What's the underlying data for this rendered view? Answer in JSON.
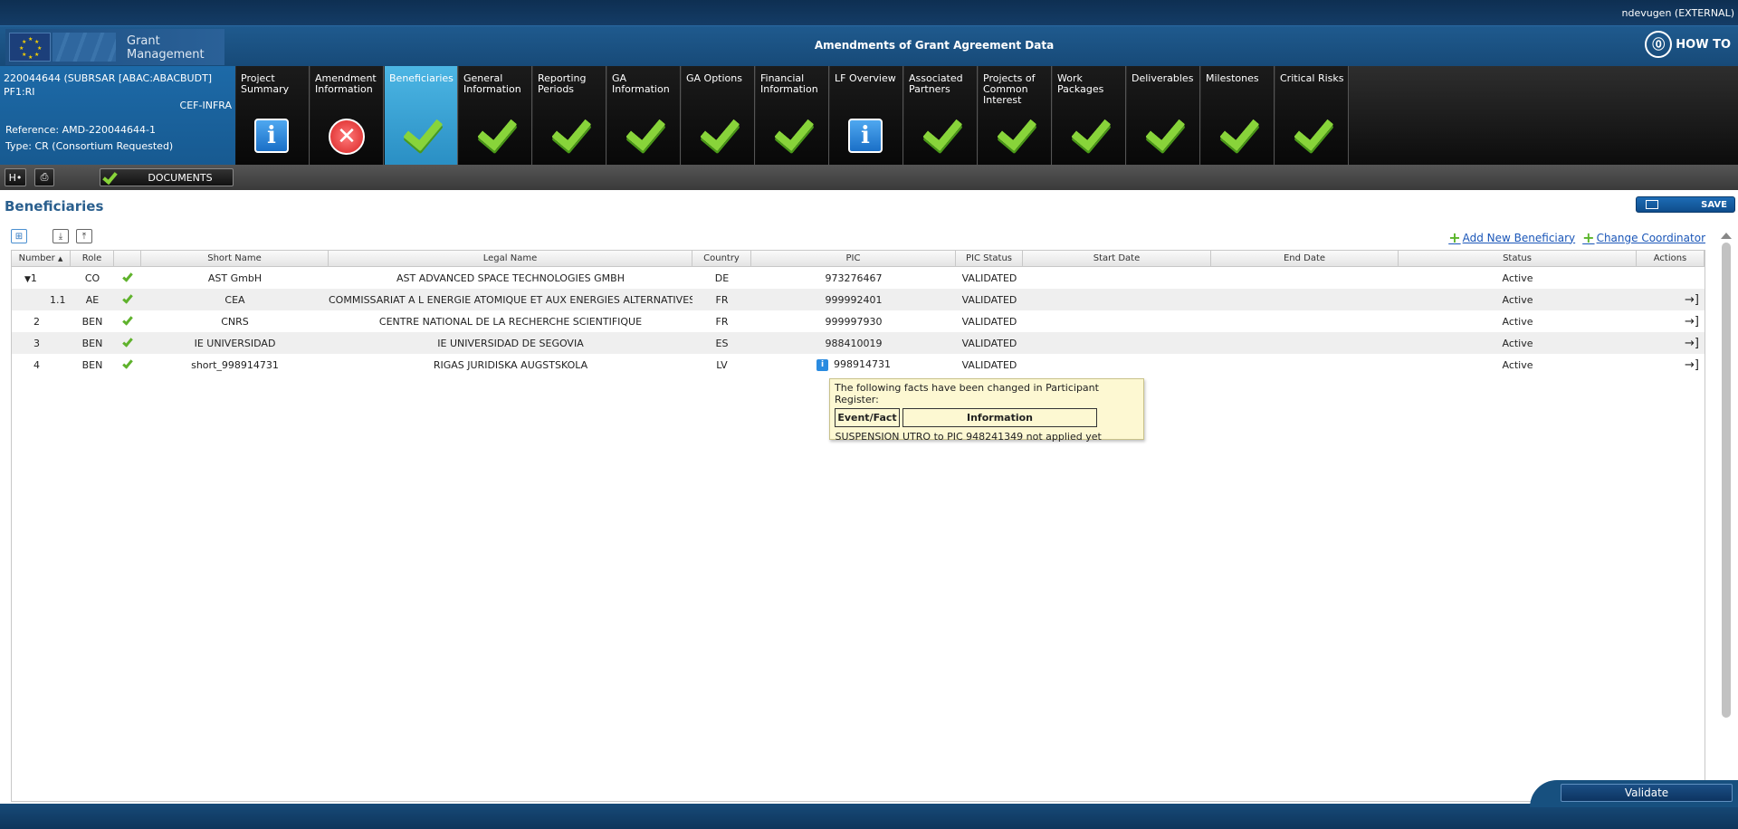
{
  "user": "ndevugen (EXTERNAL)",
  "header": {
    "logo_line1": "Grant",
    "logo_line2": "Management",
    "title": "Amendments of Grant Agreement Data",
    "howto": "HOW TO"
  },
  "project": {
    "line1": "220044644 (SUBRSAR [ABAC:ABACBUDT] PF1:RI",
    "line1b": "CEF-INFRA",
    "reference": "Reference: AMD-220044644-1",
    "type": "Type: CR (Consortium Requested)"
  },
  "tabs": [
    {
      "label": "Project Summary",
      "status": "info"
    },
    {
      "label": "Amendment Information",
      "status": "error"
    },
    {
      "label": "Beneficiaries",
      "status": "check",
      "active": true
    },
    {
      "label": "General Information",
      "status": "check"
    },
    {
      "label": "Reporting Periods",
      "status": "check"
    },
    {
      "label": "GA Information",
      "status": "check"
    },
    {
      "label": "GA Options",
      "status": "check"
    },
    {
      "label": "Financial Information",
      "status": "check"
    },
    {
      "label": "LF Overview",
      "status": "info"
    },
    {
      "label": "Associated Partners",
      "status": "check"
    },
    {
      "label": "Projects of Common Interest",
      "status": "check"
    },
    {
      "label": "Work Packages",
      "status": "check"
    },
    {
      "label": "Deliverables",
      "status": "check"
    },
    {
      "label": "Milestones",
      "status": "check"
    },
    {
      "label": "Critical Risks",
      "status": "check"
    }
  ],
  "toolbar": {
    "documents": "DOCUMENTS"
  },
  "page": {
    "title": "Beneficiaries",
    "save": "SAVE",
    "add_beneficiary": "Add New Beneficiary",
    "change_coordinator": "Change Coordinator"
  },
  "grid": {
    "columns": [
      "Number",
      "Role",
      "",
      "Short Name",
      "Legal Name",
      "Country",
      "PIC",
      "PIC Status",
      "Start Date",
      "End Date",
      "Status",
      "Actions"
    ],
    "sort_indicator": "▲",
    "rows": [
      {
        "number": "1",
        "role": "CO",
        "short": "AST GmbH",
        "legal": "AST ADVANCED SPACE TECHNOLOGIES GMBH",
        "country": "DE",
        "pic": "973276467",
        "pic_status": "VALIDATED",
        "start": "",
        "end": "",
        "status": "Active"
      },
      {
        "number": "1.1",
        "role": "AE",
        "short": "CEA",
        "legal": "COMMISSARIAT A L ENERGIE ATOMIQUE ET AUX ENERGIES ALTERNATIVES",
        "country": "FR",
        "pic": "999992401",
        "pic_status": "VALIDATED",
        "start": "",
        "end": "",
        "status": "Active"
      },
      {
        "number": "2",
        "role": "BEN",
        "short": "CNRS",
        "legal": "CENTRE NATIONAL DE LA RECHERCHE SCIENTIFIQUE",
        "country": "FR",
        "pic": "999997930",
        "pic_status": "VALIDATED",
        "start": "",
        "end": "",
        "status": "Active"
      },
      {
        "number": "3",
        "role": "BEN",
        "short": "IE UNIVERSIDAD",
        "legal": "IE UNIVERSIDAD DE SEGOVIA",
        "country": "ES",
        "pic": "988410019",
        "pic_status": "VALIDATED",
        "start": "",
        "end": "",
        "status": "Active"
      },
      {
        "number": "4",
        "role": "BEN",
        "short": "short_998914731",
        "legal": "RIGAS JURIDISKA AUGSTSKOLA",
        "country": "LV",
        "pic": "998914731",
        "pic_status": "VALIDATED",
        "start": "",
        "end": "",
        "status": "Active"
      }
    ]
  },
  "tooltip": {
    "title": "The following facts have been changed in Participant Register:",
    "col1": "Event/Fact",
    "col2": "Information",
    "event": "SUSPENSION",
    "info": "UTRO to PIC 948241349 not applied yet"
  },
  "footer": {
    "validate": "Validate"
  }
}
